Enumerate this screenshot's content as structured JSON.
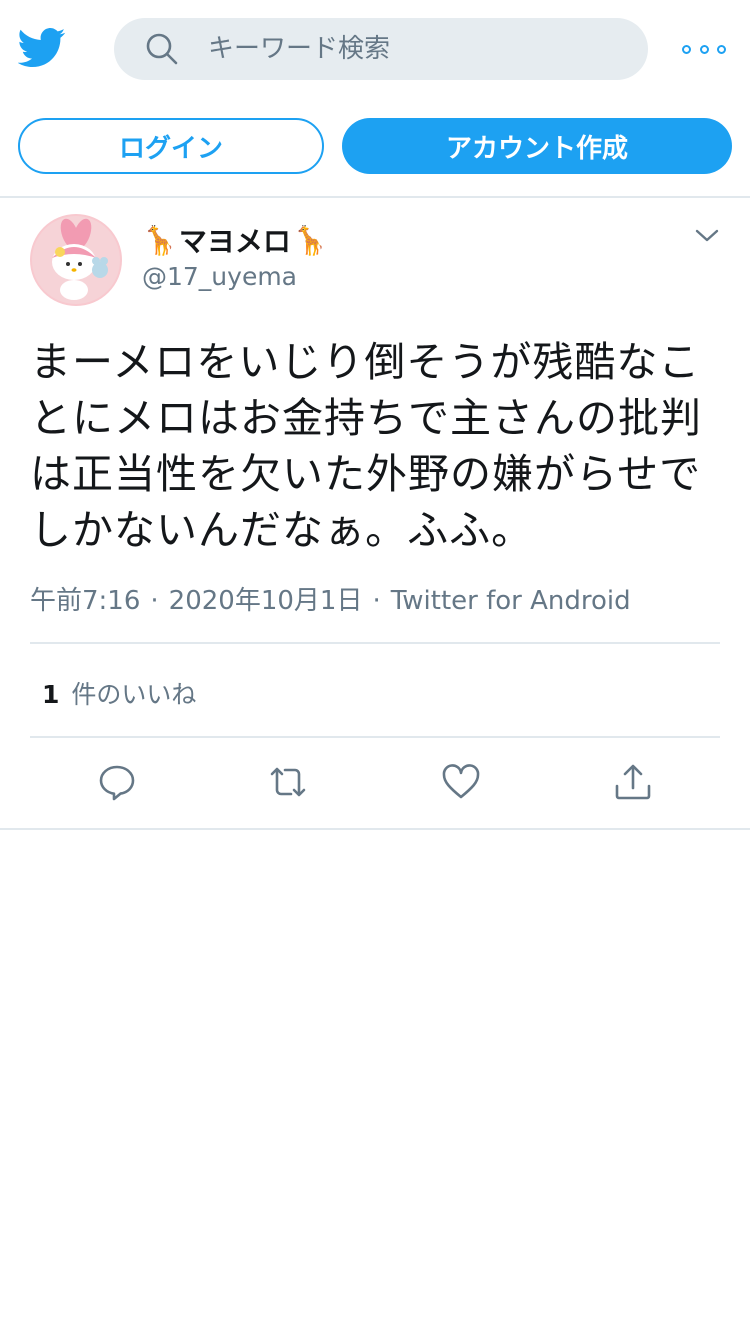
{
  "colors": {
    "accent": "#1da1f2",
    "secondary_text": "#657786",
    "search_bg": "#e6ecf0",
    "divider": "#e1e8ed"
  },
  "header": {
    "logo_icon": "twitter-bird-icon",
    "search": {
      "placeholder": "キーワード検索",
      "icon": "search-icon"
    },
    "more_icon": "more-dots-icon",
    "login_label": "ログイン",
    "signup_label": "アカウント作成"
  },
  "tweet": {
    "author": {
      "emoji_left": "🦒",
      "name": "マヨメロ",
      "emoji_right": "🦒",
      "handle": "@17_uyema",
      "avatar": "my-melody-avatar"
    },
    "menu_icon": "chevron-down-icon",
    "text": "まーメロをいじり倒そうが残酷なことにメロはお金持ちで主さんの批判は正当性を欠いた外野の嫌がらせでしかないんだなぁ。ふふ。",
    "time": "午前7:16",
    "date": "2020年10月1日",
    "separator": "·",
    "source": "Twitter for Android",
    "likes": {
      "count": "1",
      "label": "件のいいね"
    },
    "actions": [
      "reply-icon",
      "retweet-icon",
      "like-icon",
      "share-icon"
    ]
  }
}
